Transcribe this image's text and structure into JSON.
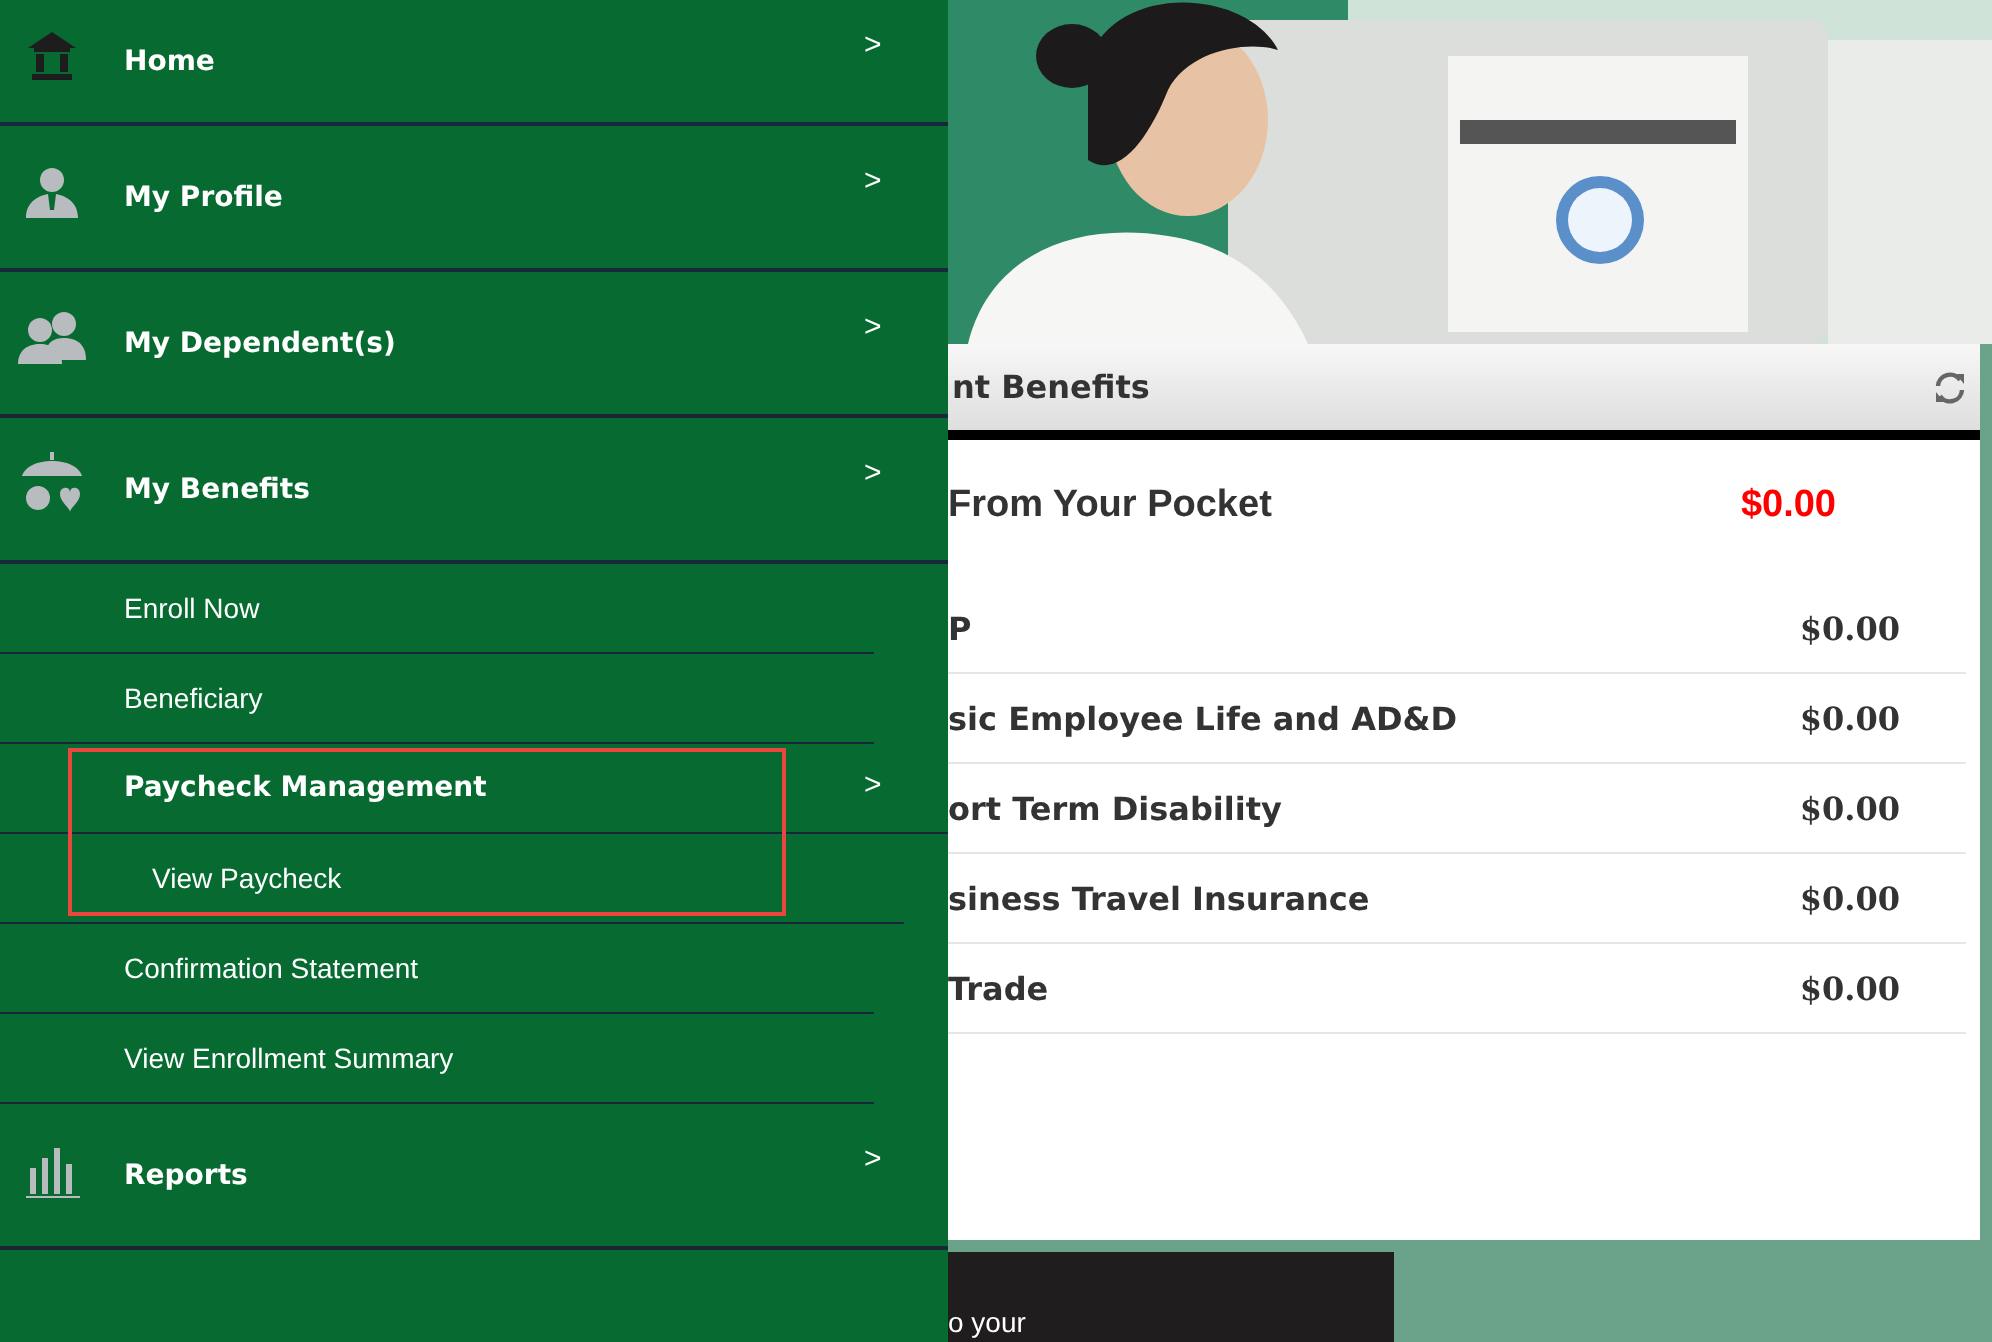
{
  "menu": [
    {
      "kind": "main",
      "label": "Home",
      "arrow": ">"
    },
    {
      "kind": "main",
      "label": "My Profile",
      "arrow": ">"
    },
    {
      "kind": "main",
      "label": "My Dependent(s)",
      "arrow": ">"
    },
    {
      "kind": "main",
      "label": "My Benefits",
      "arrow": ">"
    },
    {
      "kind": "sub",
      "label": "Enroll Now"
    },
    {
      "kind": "sub",
      "label": "Beneficiary"
    },
    {
      "kind": "group",
      "label": "Paycheck Management",
      "arrow": ">",
      "highlighted": true,
      "children": [
        {
          "label": "View Paycheck"
        }
      ]
    },
    {
      "kind": "sub",
      "label": "Confirmation Statement"
    },
    {
      "kind": "sub",
      "label": "View Enrollment Summary"
    },
    {
      "kind": "main",
      "label": "Reports",
      "arrow": ">"
    }
  ],
  "panel": {
    "title": "nt Benefits",
    "summary": {
      "label": "From Your Pocket",
      "amount": "$0.00"
    },
    "rows": [
      {
        "label": "P",
        "amount": "$0.00"
      },
      {
        "label": "sic Employee Life and AD&D",
        "amount": "$0.00"
      },
      {
        "label": "ort Term Disability",
        "amount": "$0.00"
      },
      {
        "label": "siness Travel Insurance",
        "amount": "$0.00"
      },
      {
        "label": "Trade",
        "amount": "$0.00"
      }
    ]
  },
  "footer_box": {
    "text": "o your"
  }
}
